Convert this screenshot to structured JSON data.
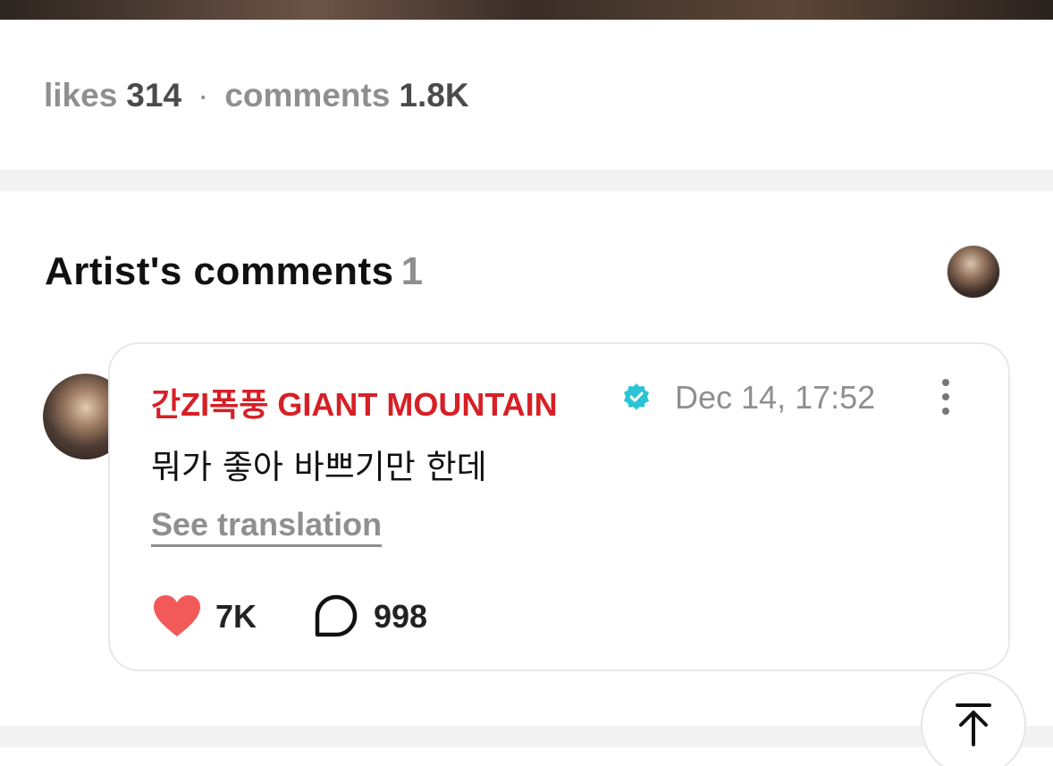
{
  "stats": {
    "likes_label": "likes",
    "likes_value": "314",
    "separator": "·",
    "comments_label": "comments",
    "comments_value": "1.8K"
  },
  "artist_comments": {
    "title": "Artist's comments",
    "count": "1"
  },
  "comment": {
    "author": "간ZI폭풍 GIANT MOUNTAIN",
    "verified_icon": "verified-badge-icon",
    "timestamp": "Dec 14, 17:52",
    "text": "뭐가 좋아 바쁘기만 한데",
    "translate_label": "See translation",
    "likes": "7K",
    "replies": "998"
  },
  "colors": {
    "author": "#d71f26",
    "heart": "#f25a5a",
    "verified": "#2bc3d6",
    "muted": "#8f8f8f"
  },
  "icons": {
    "more": "more-vertical-icon",
    "like": "heart-icon",
    "reply": "comment-bubble-icon",
    "scroll_top": "arrow-up-to-top-icon"
  }
}
